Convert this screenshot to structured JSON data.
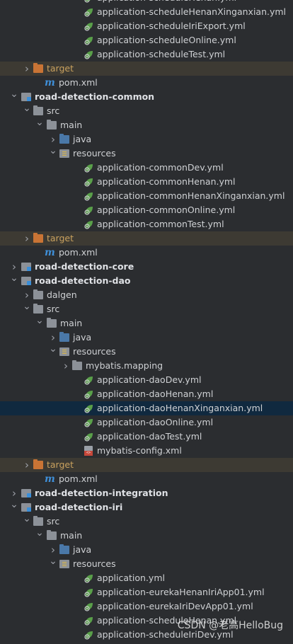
{
  "tree": [
    {
      "label": "application-scheduleHenan.yml",
      "icon": "spring-leaf-icon",
      "depth": 5
    },
    {
      "label": "application-scheduleHenanXinganxian.yml",
      "icon": "spring-leaf-icon",
      "depth": 5
    },
    {
      "label": "application-scheduleIriExport.yml",
      "icon": "spring-leaf-icon",
      "depth": 5
    },
    {
      "label": "application-scheduleOnline.yml",
      "icon": "spring-leaf-icon",
      "depth": 5
    },
    {
      "label": "application-scheduleTest.yml",
      "icon": "spring-leaf-icon",
      "depth": 5
    },
    {
      "label": "target",
      "icon": "excluded-folder-icon",
      "depth": 2,
      "chevron": "collapsed",
      "style": "orange",
      "rowhl": "orange"
    },
    {
      "label": "pom.xml",
      "icon": "maven-icon",
      "depth": 2
    },
    {
      "label": "road-detection-common",
      "icon": "module-folder-icon",
      "depth": 1,
      "chevron": "expanded",
      "style": "bold"
    },
    {
      "label": "src",
      "icon": "folder-icon",
      "depth": 2,
      "chevron": "expanded"
    },
    {
      "label": "main",
      "icon": "folder-icon",
      "depth": 3,
      "chevron": "expanded"
    },
    {
      "label": "java",
      "icon": "source-folder-icon",
      "depth": 4,
      "chevron": "collapsed"
    },
    {
      "label": "resources",
      "icon": "resources-folder-icon",
      "depth": 4,
      "chevron": "expanded"
    },
    {
      "label": "application-commonDev.yml",
      "icon": "spring-leaf-icon",
      "depth": 5
    },
    {
      "label": "application-commonHenan.yml",
      "icon": "spring-leaf-icon",
      "depth": 5
    },
    {
      "label": "application-commonHenanXinganxian.yml",
      "icon": "spring-leaf-icon",
      "depth": 5
    },
    {
      "label": "application-commonOnline.yml",
      "icon": "spring-leaf-icon",
      "depth": 5
    },
    {
      "label": "application-commonTest.yml",
      "icon": "spring-leaf-icon",
      "depth": 5
    },
    {
      "label": "target",
      "icon": "excluded-folder-icon",
      "depth": 2,
      "chevron": "collapsed",
      "style": "orange",
      "rowhl": "orange"
    },
    {
      "label": "pom.xml",
      "icon": "maven-icon",
      "depth": 2
    },
    {
      "label": "road-detection-core",
      "icon": "module-folder-icon",
      "depth": 1,
      "chevron": "collapsed",
      "style": "bold"
    },
    {
      "label": "road-detection-dao",
      "icon": "module-folder-icon",
      "depth": 1,
      "chevron": "expanded",
      "style": "bold"
    },
    {
      "label": "dalgen",
      "icon": "folder-icon",
      "depth": 2,
      "chevron": "collapsed"
    },
    {
      "label": "src",
      "icon": "folder-icon",
      "depth": 2,
      "chevron": "expanded"
    },
    {
      "label": "main",
      "icon": "folder-icon",
      "depth": 3,
      "chevron": "expanded"
    },
    {
      "label": "java",
      "icon": "source-folder-icon",
      "depth": 4,
      "chevron": "collapsed"
    },
    {
      "label": "resources",
      "icon": "resources-folder-icon",
      "depth": 4,
      "chevron": "expanded"
    },
    {
      "label": "mybatis.mapping",
      "icon": "folder-icon",
      "depth": 5,
      "chevron": "collapsed"
    },
    {
      "label": "application-daoDev.yml",
      "icon": "spring-leaf-icon",
      "depth": 5
    },
    {
      "label": "application-daoHenan.yml",
      "icon": "spring-leaf-icon",
      "depth": 5
    },
    {
      "label": "application-daoHenanXinganxian.yml",
      "icon": "spring-leaf-icon",
      "depth": 5,
      "rowhl": "blue"
    },
    {
      "label": "application-daoOnline.yml",
      "icon": "spring-leaf-icon",
      "depth": 5
    },
    {
      "label": "application-daoTest.yml",
      "icon": "spring-leaf-icon",
      "depth": 5
    },
    {
      "label": "mybatis-config.xml",
      "icon": "xml-file-icon",
      "depth": 5
    },
    {
      "label": "target",
      "icon": "excluded-folder-icon",
      "depth": 2,
      "chevron": "collapsed",
      "style": "orange",
      "rowhl": "orange"
    },
    {
      "label": "pom.xml",
      "icon": "maven-icon",
      "depth": 2
    },
    {
      "label": "road-detection-integration",
      "icon": "module-folder-icon",
      "depth": 1,
      "chevron": "collapsed",
      "style": "bold"
    },
    {
      "label": "road-detection-iri",
      "icon": "module-folder-icon",
      "depth": 1,
      "chevron": "expanded",
      "style": "bold"
    },
    {
      "label": "src",
      "icon": "folder-icon",
      "depth": 2,
      "chevron": "expanded"
    },
    {
      "label": "main",
      "icon": "folder-icon",
      "depth": 3,
      "chevron": "expanded"
    },
    {
      "label": "java",
      "icon": "source-folder-icon",
      "depth": 4,
      "chevron": "collapsed"
    },
    {
      "label": "resources",
      "icon": "resources-folder-icon",
      "depth": 4,
      "chevron": "expanded"
    },
    {
      "label": "application.yml",
      "icon": "spring-leaf-icon",
      "depth": 5
    },
    {
      "label": "application-eurekaHenanIriApp01.yml",
      "icon": "spring-leaf-icon",
      "depth": 5
    },
    {
      "label": "application-eurekaIriDevApp01.yml",
      "icon": "spring-leaf-icon",
      "depth": 5
    },
    {
      "label": "application-scheduleHenan.yml",
      "icon": "spring-leaf-icon",
      "depth": 5
    },
    {
      "label": "application-scheduleIriDev.yml",
      "icon": "spring-leaf-icon",
      "depth": 5
    }
  ],
  "watermark": "CSDN @老高HelloBug",
  "colors": {
    "background": "#2b2d30",
    "selected_row": "#10293f",
    "excluded_row": "#3d3a33",
    "excluded_text": "#c9a15e"
  }
}
